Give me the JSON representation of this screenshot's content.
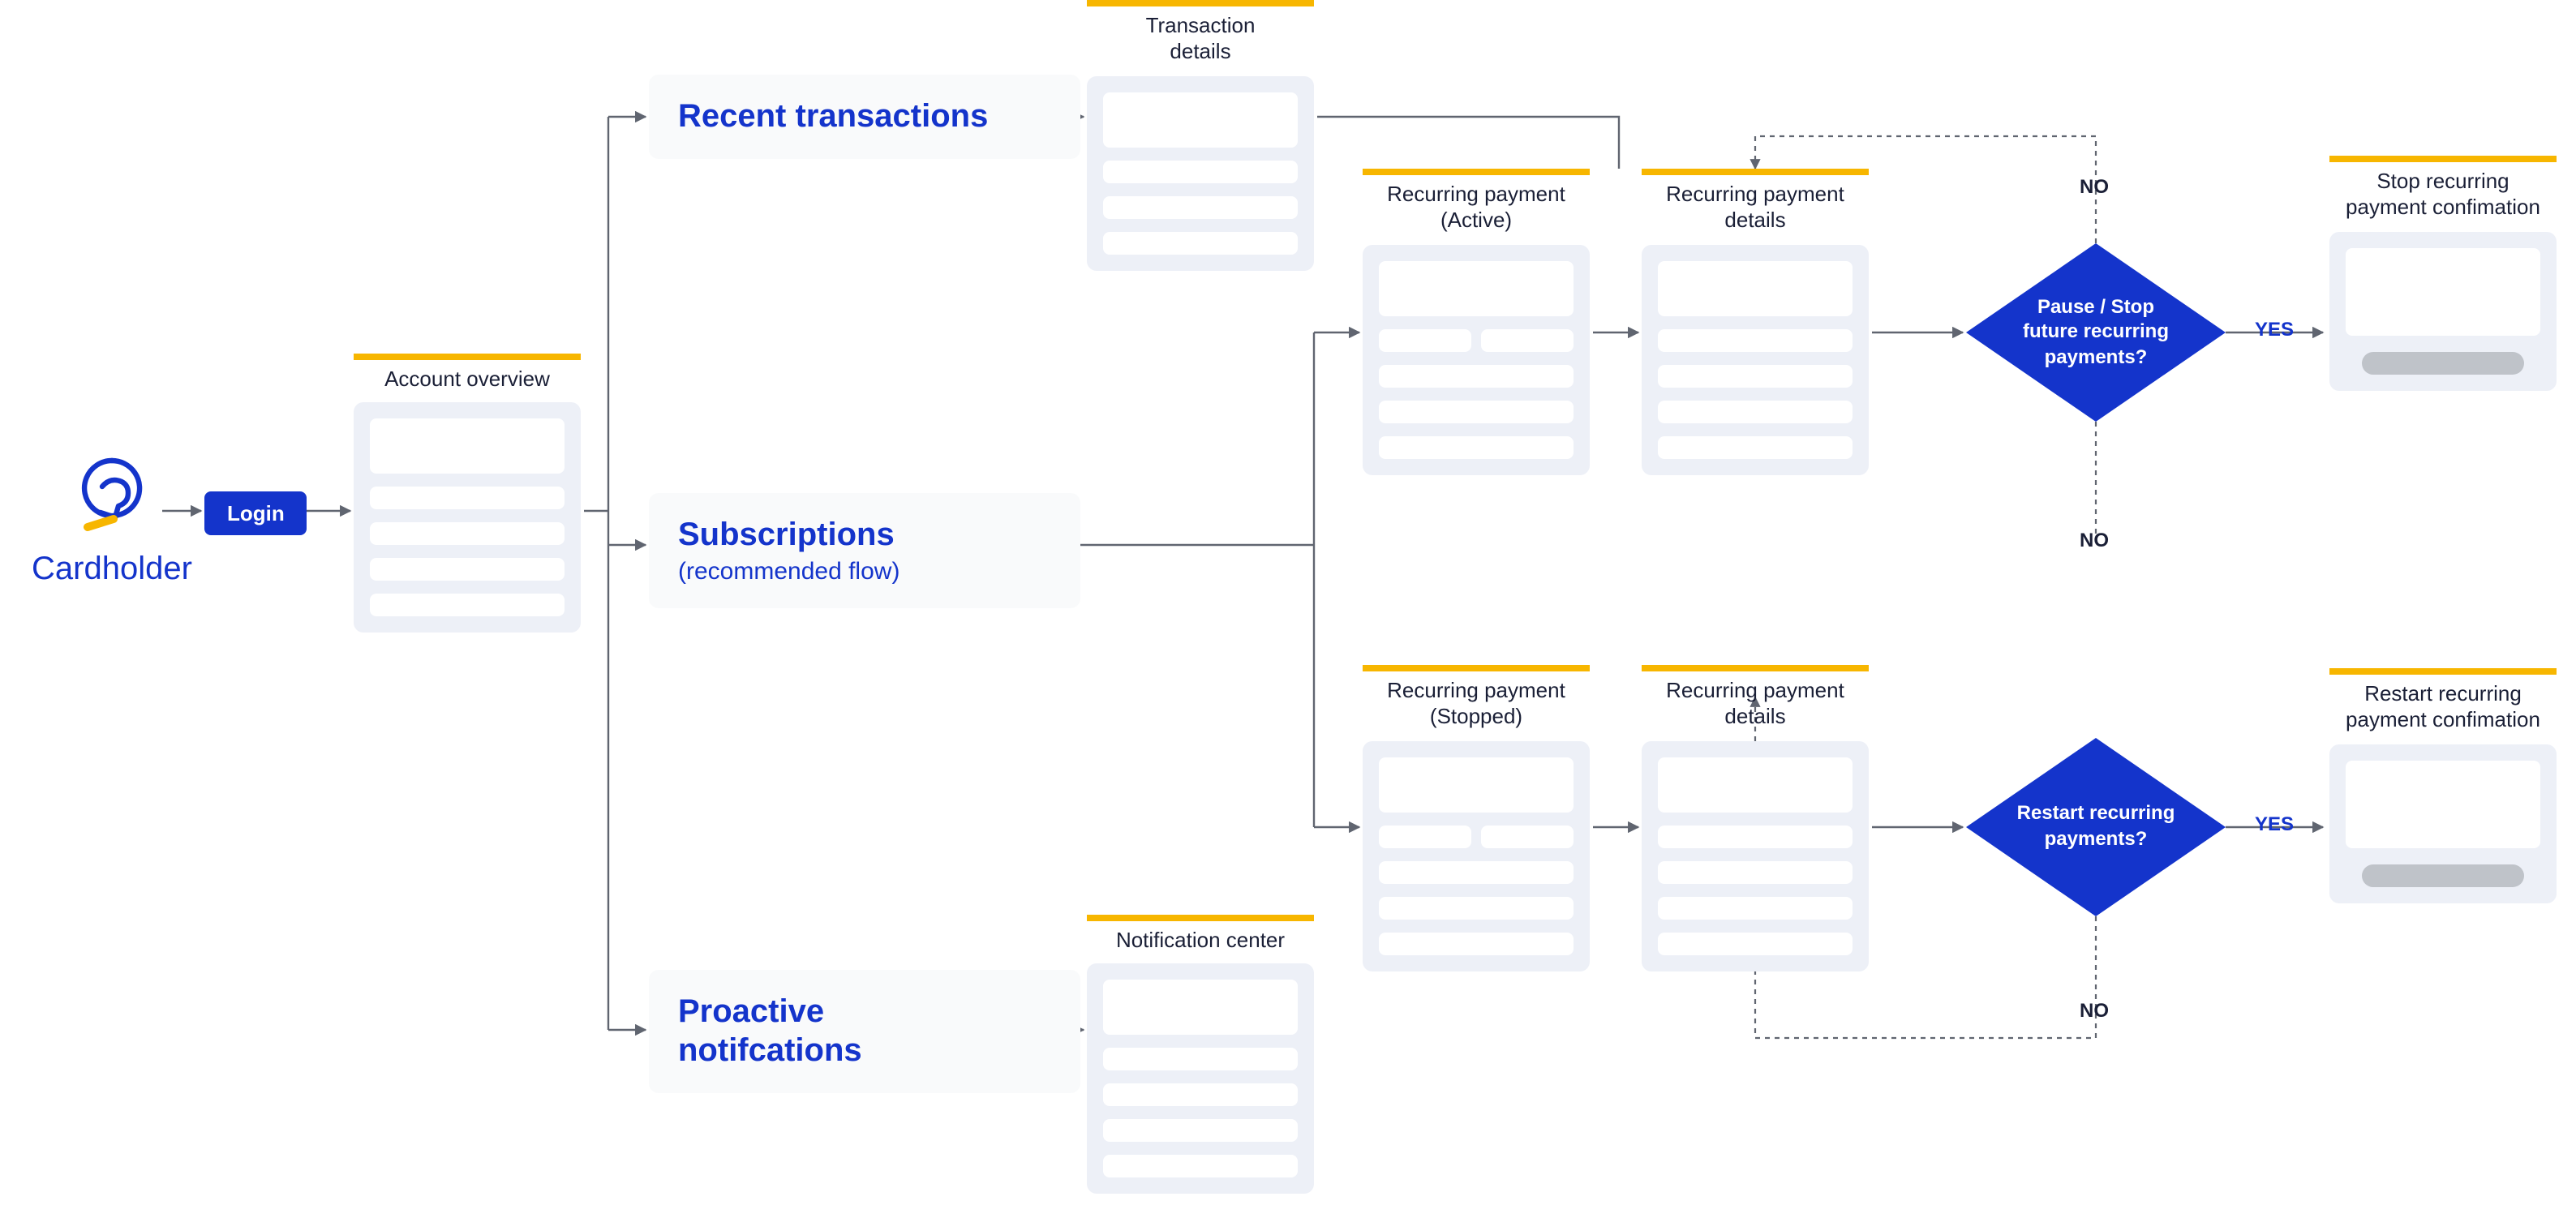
{
  "actor": {
    "label": "Cardholder"
  },
  "login": {
    "label": "Login"
  },
  "screens": {
    "account_overview": {
      "title": "Account overview"
    },
    "transaction_details": {
      "title": "Transaction\ndetails"
    },
    "notification_center": {
      "title": "Notification center"
    },
    "rp_active": {
      "title": "Recurring payment\n(Active)"
    },
    "rp_active_details": {
      "title": "Recurring payment\ndetails"
    },
    "rp_stopped": {
      "title": "Recurring payment\n(Stopped)"
    },
    "rp_stopped_details": {
      "title": "Recurring payment\ndetails"
    },
    "stop_confirm": {
      "title": "Stop recurring\npayment confimation"
    },
    "restart_confirm": {
      "title": "Restart recurring\npayment confimation"
    }
  },
  "nav": {
    "recent": {
      "title": "Recent transactions"
    },
    "subscriptions": {
      "title": "Subscriptions",
      "subtitle": "(recommended flow)"
    },
    "proactive": {
      "title": "Proactive\nnotifcations"
    }
  },
  "decisions": {
    "pause_stop": {
      "text": "Pause / Stop\nfuture recurring\npayments?"
    },
    "restart": {
      "text": "Restart recurring\npayments?"
    }
  },
  "edges": {
    "yes": "YES",
    "no": "NO"
  }
}
